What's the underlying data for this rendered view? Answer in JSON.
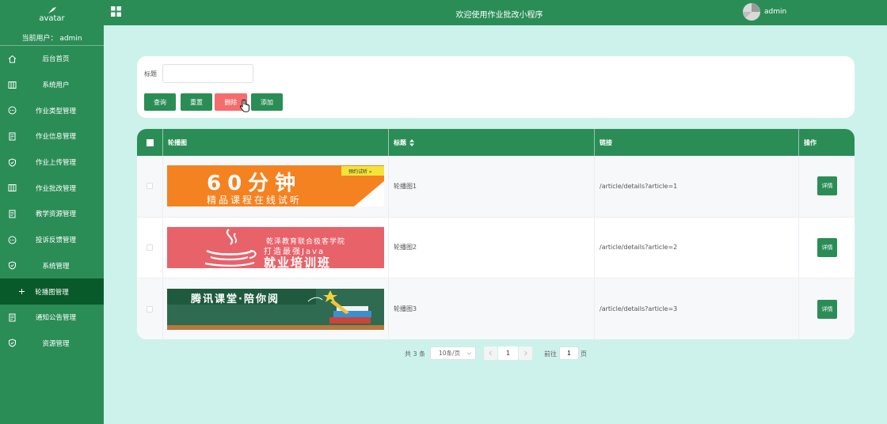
{
  "sidebar": {
    "brand_text": "avatar",
    "current_user": "当前用户： admin",
    "items": [
      {
        "label": "后台首页",
        "icon": "home-icon"
      },
      {
        "label": "系统用户",
        "icon": "columns-icon"
      },
      {
        "label": "作业类型管理",
        "icon": "chat-icon"
      },
      {
        "label": "作业信息管理",
        "icon": "document-icon"
      },
      {
        "label": "作业上传管理",
        "icon": "shield-icon"
      },
      {
        "label": "作业批改管理",
        "icon": "columns-icon"
      },
      {
        "label": "教学资源管理",
        "icon": "document-icon"
      },
      {
        "label": "投诉反馈管理",
        "icon": "chat-icon"
      },
      {
        "label": "系统管理",
        "icon": "shield-icon"
      },
      {
        "label": "轮播图管理",
        "icon": "plus-icon",
        "active": true
      },
      {
        "label": "通知公告管理",
        "icon": "document-icon"
      },
      {
        "label": "资源管理",
        "icon": "shield-icon"
      }
    ]
  },
  "header": {
    "title": "欢迎使用作业批改小程序",
    "username": "admin"
  },
  "search": {
    "label": "标题",
    "value": "",
    "placeholder": "",
    "buttons": {
      "query": "查询",
      "reset": "重置",
      "delete": "删除",
      "add": "添加"
    }
  },
  "table": {
    "columns": {
      "image": "轮播图",
      "title": "标题",
      "link": "链接",
      "actions": "操作"
    },
    "rows": [
      {
        "title": "轮播图1",
        "link": "/article/details?article=1",
        "detail_label": "详情",
        "banner": {
          "line1": "60分钟",
          "line2": "精品课程在线试听",
          "tag": "预约试听 »"
        }
      },
      {
        "title": "轮播图2",
        "link": "/article/details?article=2",
        "detail_label": "详情",
        "banner": {
          "line1": "乾泽教育联合极客学院",
          "line2": "打造最强Java",
          "line3": "就业培训班"
        }
      },
      {
        "title": "轮播图3",
        "link": "/article/details?article=3",
        "detail_label": "详情",
        "banner": {
          "line1": "腾讯课堂·陪你阅"
        }
      }
    ]
  },
  "pagination": {
    "total": "共 3 条",
    "page_size": "10条/页",
    "current_page": "1",
    "goto_label": "前往",
    "goto_value": "1",
    "page_unit": "页"
  },
  "colors": {
    "primary": "#2b8d56",
    "primary_dark": "#085a2a",
    "danger": "#f56c6c",
    "page_bg": "#cdf2ec"
  }
}
